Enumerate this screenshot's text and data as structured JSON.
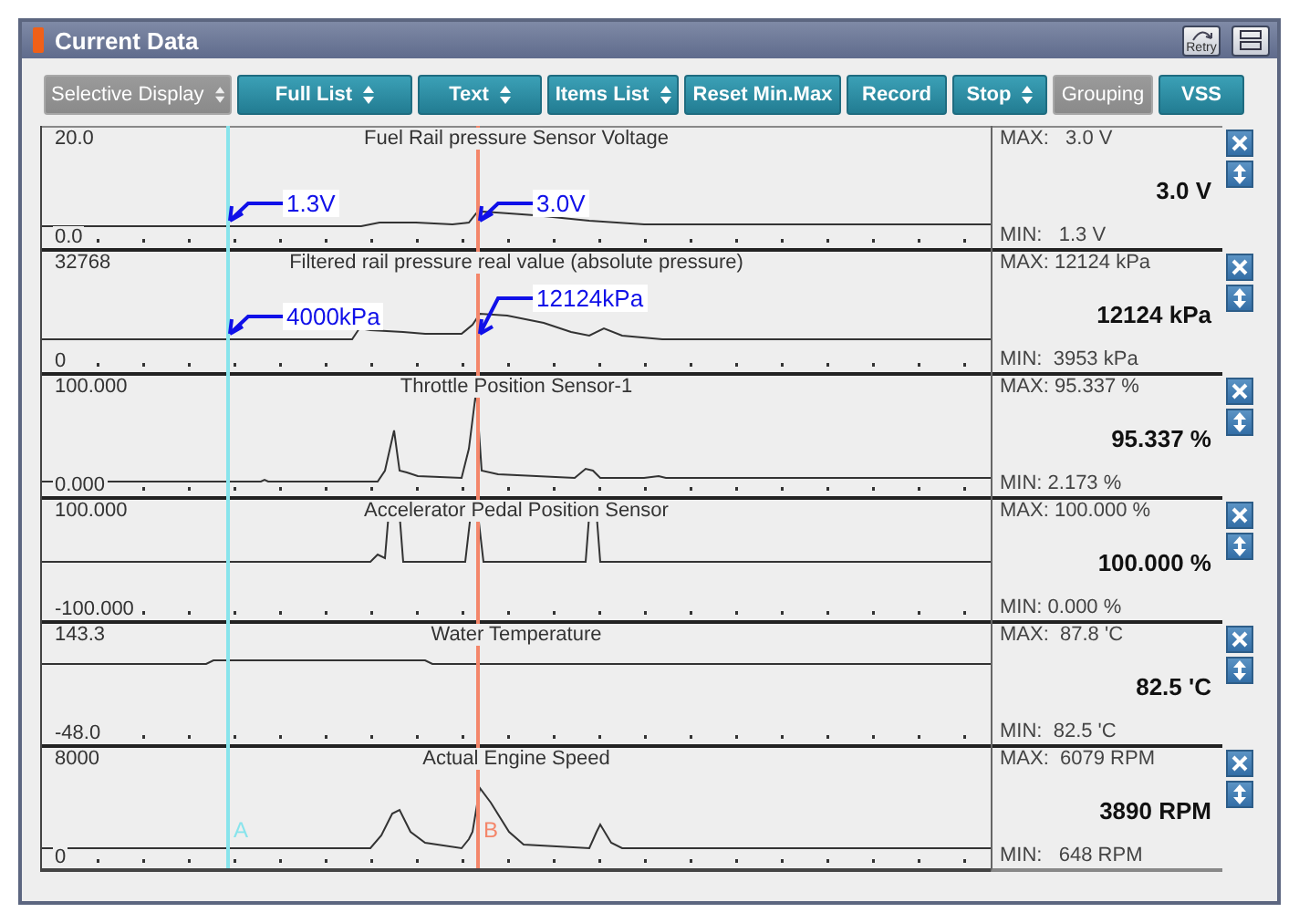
{
  "window": {
    "title": "Current Data",
    "retry_label": "Retry"
  },
  "toolbar": [
    {
      "label": "Selective Display",
      "kind": "dropdown",
      "disabled": true
    },
    {
      "label": "Full List",
      "kind": "dropdown",
      "disabled": false
    },
    {
      "label": "Text",
      "kind": "dropdown",
      "disabled": false
    },
    {
      "label": "Items List",
      "kind": "dropdown",
      "disabled": false
    },
    {
      "label": "Reset Min.Max",
      "kind": "button",
      "disabled": false
    },
    {
      "label": "Record",
      "kind": "button",
      "disabled": false
    },
    {
      "label": "Stop",
      "kind": "dropdown",
      "disabled": false
    },
    {
      "label": "Grouping",
      "kind": "button",
      "disabled": true
    },
    {
      "label": "VSS",
      "kind": "button",
      "disabled": false
    }
  ],
  "cursors": [
    {
      "label": "A",
      "color": "#88e4ec"
    },
    {
      "label": "B",
      "color": "#f4866a"
    }
  ],
  "channels": [
    {
      "name": "Fuel Rail pressure Sensor Voltage",
      "scale_max": "20.0",
      "scale_min": "0.0",
      "max": "MAX:   3.0 V",
      "value": "3.0 V",
      "min": "MIN:   1.3 V",
      "annotations": [
        {
          "text": "1.3V"
        },
        {
          "text": "3.0V"
        }
      ]
    },
    {
      "name": "Filtered rail pressure real value (absolute pressure)",
      "scale_max": "32768",
      "scale_min": "0",
      "max": "MAX: 12124 kPa",
      "value": "12124 kPa",
      "min": "MIN:  3953 kPa",
      "annotations": [
        {
          "text": "4000kPa"
        },
        {
          "text": "12124kPa"
        }
      ]
    },
    {
      "name": "Throttle Position Sensor-1",
      "scale_max": "100.000",
      "scale_min": "0.000",
      "max": "MAX: 95.337 %",
      "value": "95.337 %",
      "min": "MIN: 2.173 %"
    },
    {
      "name": "Accelerator Pedal Position Sensor",
      "scale_max": "100.000",
      "scale_min": "-100.000",
      "max": "MAX: 100.000 %",
      "value": "100.000 %",
      "min": "MIN: 0.000 %"
    },
    {
      "name": "Water Temperature",
      "scale_max": "143.3",
      "scale_min": "-48.0",
      "max": "MAX:  87.8 'C",
      "value": "82.5 'C",
      "min": "MIN:  82.5 'C"
    },
    {
      "name": "Actual Engine Speed",
      "scale_max": "8000",
      "scale_min": "0",
      "max": "MAX:  6079 RPM",
      "value": "3890 RPM",
      "min": "MIN:   648 RPM"
    }
  ]
}
